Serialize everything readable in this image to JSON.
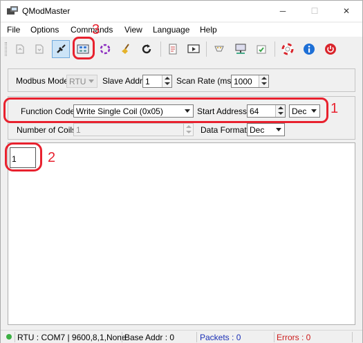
{
  "window": {
    "title": "QModMaster",
    "controls": {
      "minimize": "─",
      "maximize": "☐",
      "close": "✕"
    }
  },
  "menu": [
    "File",
    "Options",
    "Commands",
    "View",
    "Language",
    "Help"
  ],
  "toolbar": {
    "buttons": [
      "load-session-icon",
      "save-session-icon",
      "connect-icon",
      "read-write-icon",
      "scan-icon",
      "clear-icon",
      "reset-counters-icon",
      "log-icon",
      "bus-monitor-icon",
      "serial-settings-icon",
      "tcp-settings-icon",
      "settings-icon",
      "help-icon",
      "about-icon",
      "exit-icon"
    ]
  },
  "modbus": {
    "mode_label": "Modbus Mode",
    "mode_value": "RTU",
    "slave_label": "Slave Addr",
    "slave_value": "1",
    "scan_label": "Scan Rate (ms)",
    "scan_value": "1000"
  },
  "function": {
    "code_label": "Function Code",
    "code_value": "Write Single Coil (0x05)",
    "start_label": "Start Address",
    "start_value": "64",
    "start_format": "Dec",
    "coils_label": "Number of Coils",
    "coils_value": "1",
    "data_format_label": "Data Format",
    "data_format_value": "Dec"
  },
  "grid": {
    "cell_value": "1"
  },
  "annotations": {
    "n1": "1",
    "n2": "2",
    "n3": "3"
  },
  "status": {
    "connection": "RTU : COM7 | 9600,8,1,None",
    "base_addr": "Base Addr : 0",
    "packets": "Packets : 0",
    "errors": "Errors : 0"
  },
  "colors": {
    "annotation": "#e8212e",
    "packets": "#1a2fb5",
    "errors": "#cc1a1a",
    "status_led": "#3cb043"
  }
}
